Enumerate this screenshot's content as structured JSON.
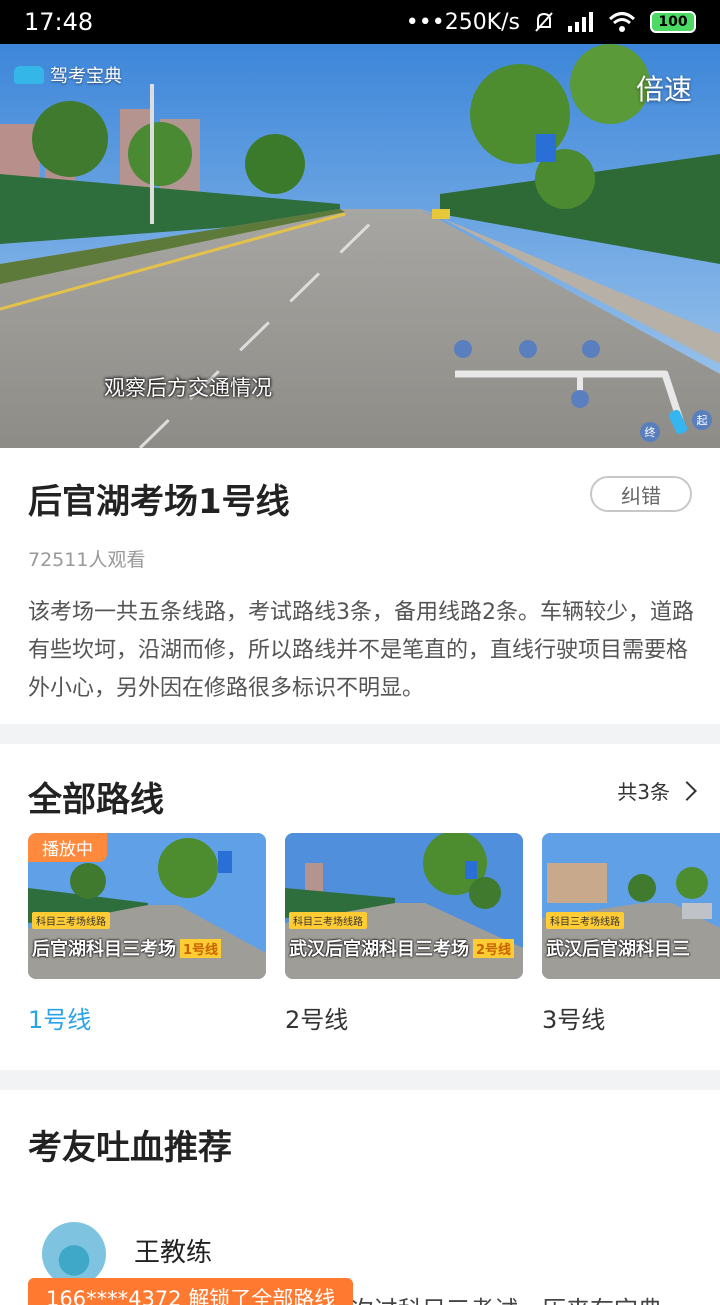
{
  "status_bar": {
    "time": "17:48",
    "net_speed": "•••250K/s",
    "battery": "100"
  },
  "video": {
    "logo_text": "驾考宝典",
    "speed_label": "倍速",
    "subtitle": "观察后方交通情况",
    "map_start": "起",
    "map_end": "终"
  },
  "info": {
    "title": "后官湖考场1号线",
    "report_label": "纠错",
    "viewers": "72511人观看",
    "description": "该考场一共五条线路，考试路线3条，备用线路2条。车辆较少，道路有些坎坷，沿湖而修，所以路线并不是笔直的，直线行驶项目需要格外小心，另外因在修路很多标识不明显。"
  },
  "routes": {
    "title": "全部路线",
    "count": "共3条",
    "items": [
      {
        "label": "1号线",
        "badge": "播放中",
        "tag": "科目三考场线路",
        "banner": "后官湖科目三考场",
        "line_tag": "1号线",
        "active": true
      },
      {
        "label": "2号线",
        "tag": "科目三考场线路",
        "banner": "武汉后官湖科目三考场",
        "line_tag": "2号线",
        "active": false
      },
      {
        "label": "3号线",
        "tag": "科目三考场线路",
        "banner": "武汉后官湖科目三",
        "line_tag": "",
        "active": false
      }
    ]
  },
  "recommend": {
    "title": "考友吐血推荐",
    "coach_name": "王教练",
    "toast": "166****4372 解锁了全部路线",
    "comment_snippet": "次过科目三考试，历来有宝典"
  },
  "colors": {
    "accent_blue": "#2aa4e6",
    "toast_orange": "#ff7a30",
    "badge_orange": "#ff8a3d"
  }
}
